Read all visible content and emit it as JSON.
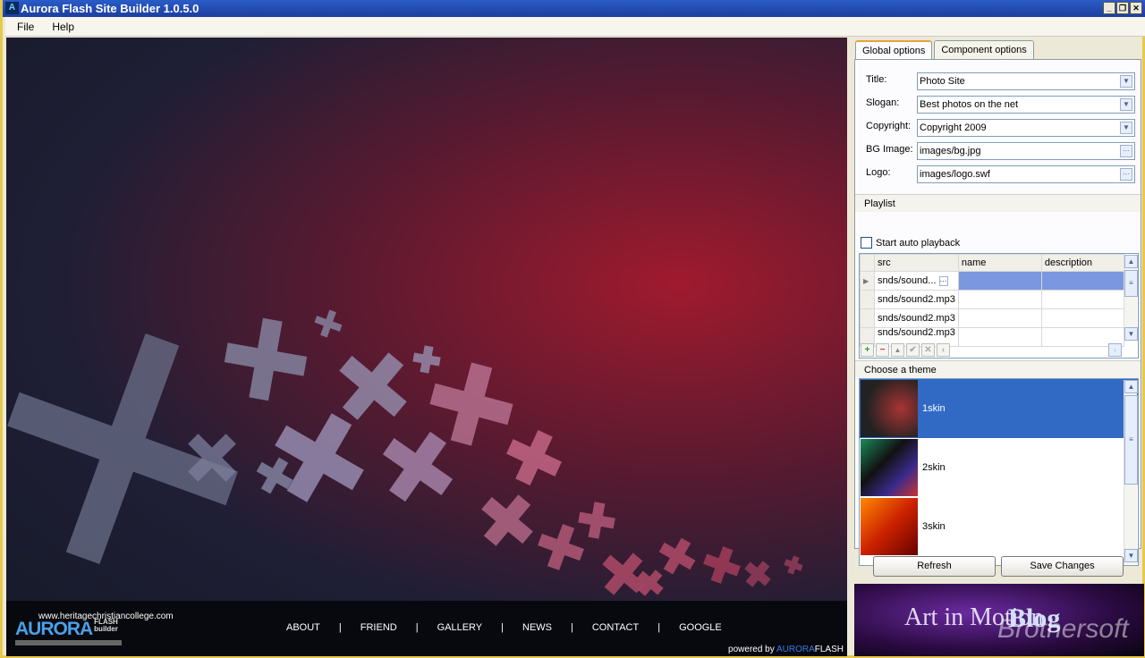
{
  "window": {
    "title": "Aurora Flash Site Builder 1.0.5.0",
    "icon": "app-icon",
    "controls": [
      "minimize",
      "restore",
      "close"
    ]
  },
  "menu": [
    "File",
    "Help"
  ],
  "preview": {
    "url": "www.heritagechristiancollege.com",
    "logo": "AURORA",
    "logo_sub1": "FLASH",
    "logo_sub2": "builder",
    "nav": [
      "ABOUT",
      "FRIEND",
      "GALLERY",
      "NEWS",
      "CONTACT",
      "GOOGLE"
    ],
    "nav_separator": "|",
    "powered_prefix": "powered by ",
    "powered_brand1": "AURORA",
    "powered_brand2": "FLASH"
  },
  "tabs": [
    {
      "label": "Global options",
      "active": true
    },
    {
      "label": "Component options",
      "active": false
    }
  ],
  "global": {
    "fields": [
      {
        "label": "Title:",
        "value": "Photo Site",
        "type": "dropdown"
      },
      {
        "label": "Slogan:",
        "value": "Best photos on the net",
        "type": "dropdown"
      },
      {
        "label": "Copyright:",
        "value": "Copyright 2009",
        "type": "dropdown"
      },
      {
        "label": "BG Image:",
        "value": "images/bg.jpg",
        "type": "browse"
      },
      {
        "label": "Logo:",
        "value": "images/logo.swf",
        "type": "browse"
      }
    ],
    "playlist_title": "Playlist",
    "auto_playback_label": "Start auto playback",
    "auto_playback": false,
    "columns": [
      "src",
      "name",
      "description"
    ],
    "rows": [
      {
        "src": "snds/sound...",
        "name": "",
        "description": ""
      },
      {
        "src": "snds/sound2.mp3",
        "name": "",
        "description": ""
      },
      {
        "src": "snds/sound2.mp3",
        "name": "",
        "description": ""
      },
      {
        "src": "snds/sound2.mp3",
        "name": "",
        "description": ""
      }
    ],
    "theme_title": "Choose a theme",
    "themes": [
      {
        "name": "1skin",
        "selected": true
      },
      {
        "name": "2skin"
      },
      {
        "name": "3skin"
      }
    ]
  },
  "buttons": {
    "refresh": "Refresh",
    "save": "Save Changes"
  },
  "banner": {
    "text1": "Art in Motion",
    "text2": "Blog",
    "watermark": "Brothersoft"
  },
  "colors": {
    "selection": "#316ac5",
    "grid_selection": "#7b97e0",
    "titlebar": "#2a5cc8"
  }
}
